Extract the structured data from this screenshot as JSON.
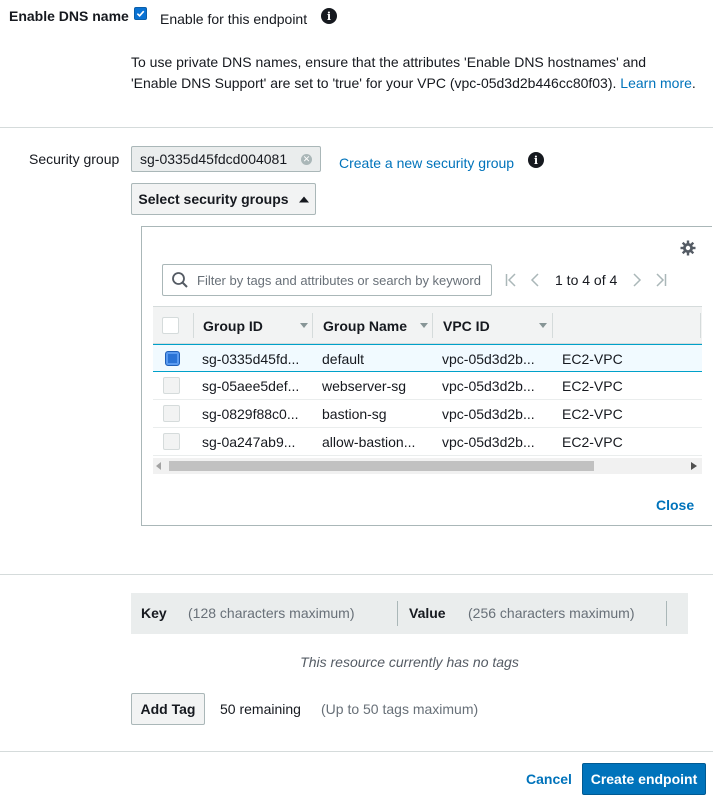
{
  "dns": {
    "label": "Enable DNS name",
    "checkbox_label": "Enable for this endpoint",
    "note": "To use private DNS names, ensure that the attributes 'Enable DNS hostnames' and 'Enable DNS Support' are set to 'true' for your VPC (vpc-05d3d2b446cc80f03).",
    "learn_more": "Learn more"
  },
  "security_group": {
    "label": "Security group",
    "selected_token": "sg-0335d45fdcd004081",
    "create_link": "Create a new security group",
    "select_button": "Select security groups"
  },
  "table": {
    "search_placeholder": "Filter by tags and attributes or search by keyword",
    "pagination": "1 to 4 of 4",
    "columns": [
      "Group ID",
      "Group Name",
      "VPC ID"
    ],
    "rows": [
      {
        "group_id": "sg-0335d45fd...",
        "group_name": "default",
        "vpc_id": "vpc-05d3d2b...",
        "type": "EC2-VPC",
        "selected": true
      },
      {
        "group_id": "sg-05aee5def...",
        "group_name": "webserver-sg",
        "vpc_id": "vpc-05d3d2b...",
        "type": "EC2-VPC",
        "selected": false
      },
      {
        "group_id": "sg-0829f88c0...",
        "group_name": "bastion-sg",
        "vpc_id": "vpc-05d3d2b...",
        "type": "EC2-VPC",
        "selected": false
      },
      {
        "group_id": "sg-0a247ab9...",
        "group_name": "allow-bastion...",
        "vpc_id": "vpc-05d3d2b...",
        "type": "EC2-VPC",
        "selected": false
      }
    ],
    "close": "Close"
  },
  "tags": {
    "key_label": "Key",
    "key_hint": "(128 characters maximum)",
    "value_label": "Value",
    "value_hint": "(256 characters maximum)",
    "empty_text": "This resource currently has no tags",
    "add_button": "Add Tag",
    "remaining": "50 remaining",
    "limit_note": "(Up to 50 tags maximum)"
  },
  "footer": {
    "cancel": "Cancel",
    "create": "Create endpoint"
  },
  "colors": {
    "link": "#0073bb",
    "primary": "#0073bb",
    "selected_row_border": "#00a1c9"
  },
  "icons": [
    "checkbox-checked-icon",
    "info-icon",
    "remove-token-icon",
    "caret-up-icon",
    "gear-icon",
    "search-icon",
    "first-page-icon",
    "prev-page-icon",
    "next-page-icon",
    "last-page-icon",
    "sort-caret-icon",
    "scroll-left-icon",
    "scroll-right-icon"
  ]
}
